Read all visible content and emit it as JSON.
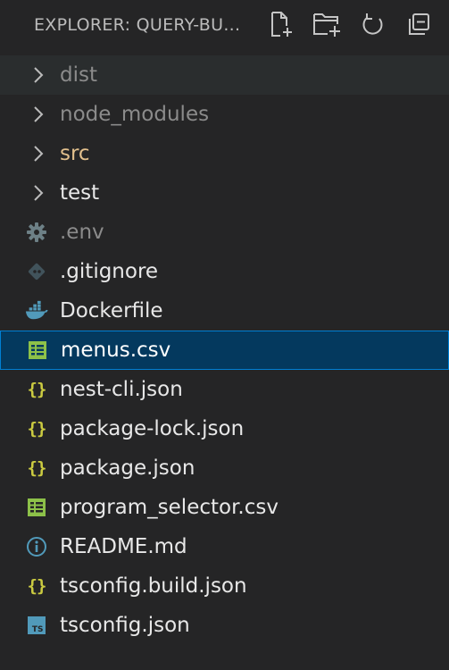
{
  "header": {
    "title": "EXPLORER: QUERY-BU..."
  },
  "tree": {
    "items": [
      {
        "label": "dist"
      },
      {
        "label": "node_modules"
      },
      {
        "label": "src"
      },
      {
        "label": "test"
      },
      {
        "label": ".env"
      },
      {
        "label": ".gitignore"
      },
      {
        "label": "Dockerfile"
      },
      {
        "label": "menus.csv"
      },
      {
        "label": "nest-cli.json"
      },
      {
        "label": "package-lock.json"
      },
      {
        "label": "package.json"
      },
      {
        "label": "program_selector.csv"
      },
      {
        "label": "README.md"
      },
      {
        "label": "tsconfig.build.json"
      },
      {
        "label": "tsconfig.json"
      }
    ]
  },
  "icons": {
    "json": "{}",
    "ts": "TS"
  },
  "colors": {
    "background": "#252526",
    "selected_bg": "#04395e",
    "selected_border": "#007fd4",
    "folder_highlight": "#e2c08d",
    "json_icon": "#cbcb41",
    "csv_icon": "#8dc149",
    "docker_icon": "#519aba"
  }
}
